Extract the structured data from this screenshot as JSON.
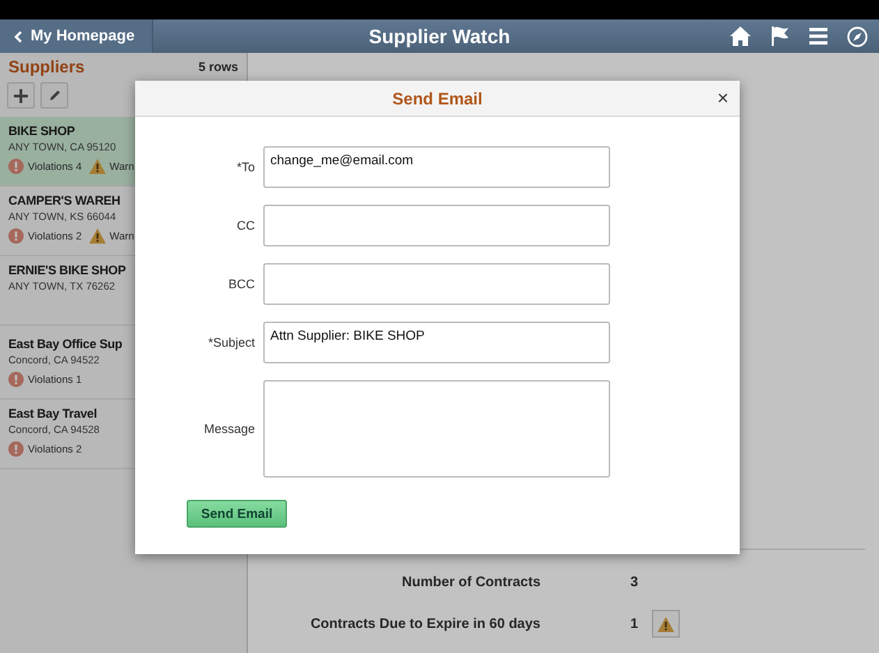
{
  "header": {
    "back_button": "My Homepage",
    "title": "Supplier Watch"
  },
  "suppliers": {
    "title": "Suppliers",
    "count": "5 rows",
    "items": [
      {
        "name": "BIKE SHOP",
        "address": "ANY TOWN, CA  95120",
        "violations": "Violations 4",
        "warnings": "Warn",
        "selected": true
      },
      {
        "name": "CAMPER'S WAREH",
        "address": "ANY TOWN, KS  66044",
        "violations": "Violations 2",
        "warnings": "Warn",
        "selected": false
      },
      {
        "name": "ERNIE'S BIKE SHOP",
        "address": "ANY TOWN, TX  76262",
        "selected": false
      },
      {
        "name": "East Bay Office Sup",
        "address": "Concord, CA  94522",
        "violations": "Violations 1",
        "selected": false
      },
      {
        "name": "East Bay Travel",
        "address": "Concord, CA  94528",
        "violations": "Violations 2",
        "selected": false
      }
    ]
  },
  "summary": [
    {
      "label": "Number of Contracts",
      "value": "3",
      "alert": false
    },
    {
      "label": "Contracts Due to Expire in 60 days",
      "value": "1",
      "alert": true
    }
  ],
  "dialog": {
    "title": "Send Email",
    "fields": [
      {
        "label": "*To",
        "value": "change_me@email.com",
        "kind": "line"
      },
      {
        "label": "CC",
        "kind": "line"
      },
      {
        "label": "BCC",
        "kind": "line"
      },
      {
        "label": "*Subject",
        "value": "Attn Supplier: BIKE SHOP",
        "kind": "line"
      },
      {
        "label": "Message",
        "kind": "area"
      }
    ],
    "close": "×",
    "button": "Send Email"
  }
}
